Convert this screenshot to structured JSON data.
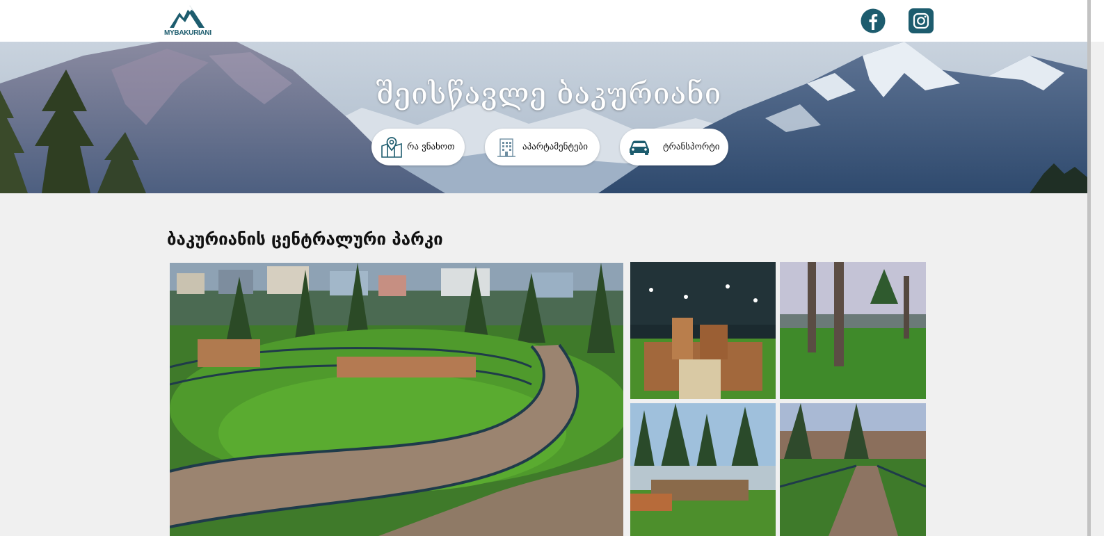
{
  "header": {
    "logo_text": "MYBAKURIANI",
    "social": [
      {
        "name": "facebook-icon",
        "color": "#1d5c6e"
      },
      {
        "name": "instagram-icon",
        "color": "#1d5c6e"
      }
    ]
  },
  "hero": {
    "title": "შეისწავლე ბაკურიანი",
    "buttons": [
      {
        "label": "რა ვნახოთ",
        "icon": "map-pin-icon"
      },
      {
        "label": "აპარტამენტები",
        "icon": "building-icon"
      },
      {
        "label": "ტრანსპორტი",
        "icon": "car-icon"
      }
    ]
  },
  "section": {
    "title": "ბაკურიანის ცენტრალური პარკი"
  },
  "colors": {
    "brand": "#1d5c6e",
    "page_background": "#f0f0f0"
  }
}
